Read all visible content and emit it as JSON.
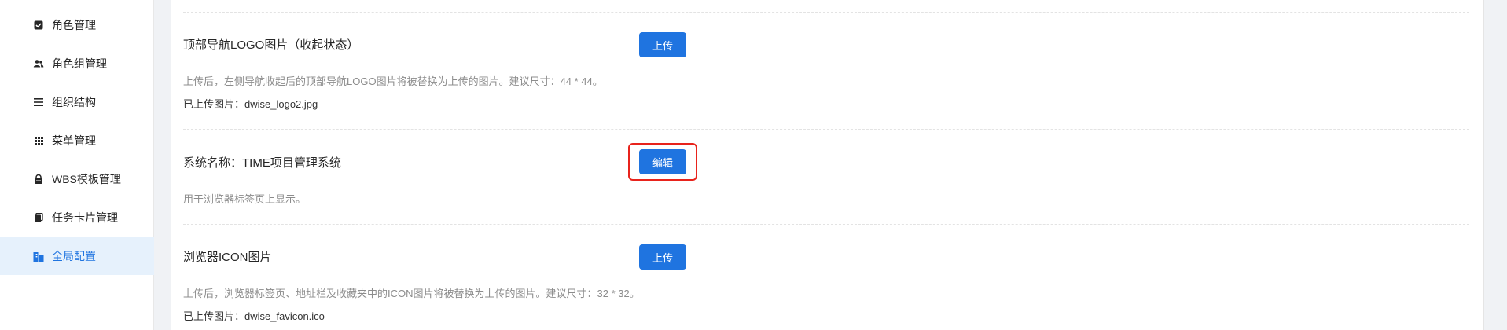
{
  "sidebar": {
    "items": [
      {
        "label": "角色管理",
        "icon": "checkbox-icon"
      },
      {
        "label": "角色组管理",
        "icon": "users-icon"
      },
      {
        "label": "组织结构",
        "icon": "list-icon"
      },
      {
        "label": "菜单管理",
        "icon": "grid-icon"
      },
      {
        "label": "WBS模板管理",
        "icon": "lock-icon"
      },
      {
        "label": "任务卡片管理",
        "icon": "cards-icon"
      },
      {
        "label": "全局配置",
        "icon": "building-icon",
        "active": true
      }
    ]
  },
  "settings": [
    {
      "title": "顶部导航LOGO图片（收起状态）",
      "button": "上传",
      "description": "上传后，左侧导航收起后的顶部导航LOGO图片将被替换为上传的图片。建议尺寸：44 * 44。",
      "file_label": "已上传图片：",
      "file_name": "dwise_logo2.jpg"
    },
    {
      "title": "系统名称：TIME项目管理系统",
      "button": "编辑",
      "description": "用于浏览器标签页上显示。"
    },
    {
      "title": "浏览器ICON图片",
      "button": "上传",
      "description": "上传后，浏览器标签页、地址栏及收藏夹中的ICON图片将被替换为上传的图片。建议尺寸：32 * 32。",
      "file_label": "已上传图片：",
      "file_name": "dwise_favicon.ico"
    }
  ],
  "colors": {
    "primary": "#1f74e0",
    "active_bg": "#e6f1fc",
    "highlight": "#e8231c"
  }
}
